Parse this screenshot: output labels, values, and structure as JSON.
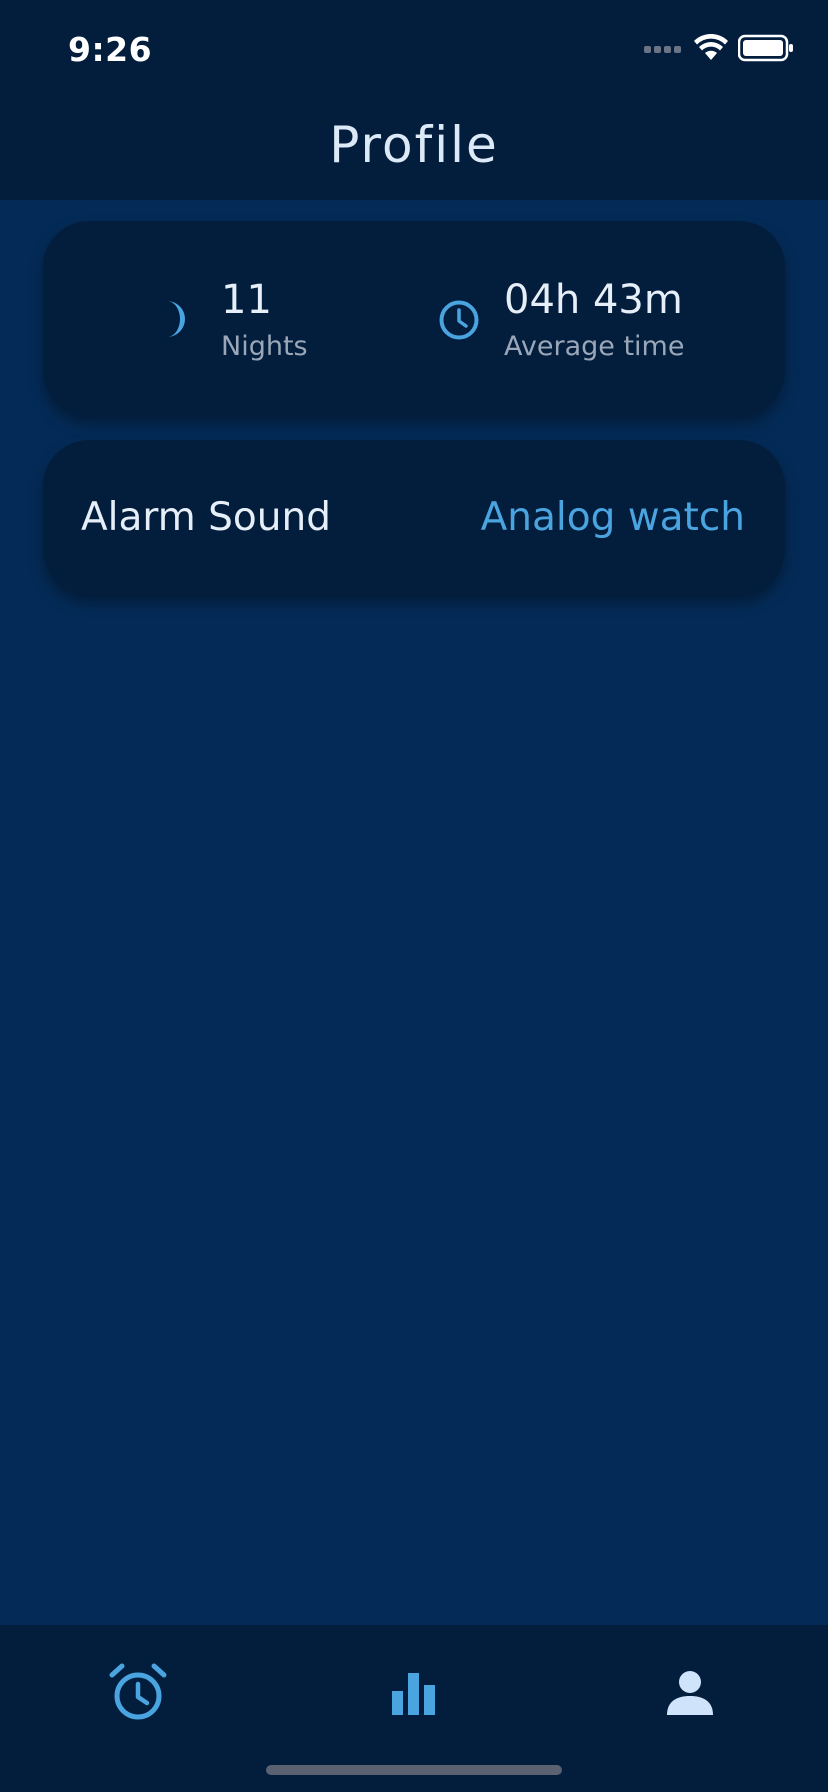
{
  "status_bar": {
    "time": "9:26"
  },
  "header": {
    "title": "Profile"
  },
  "stats": {
    "nights": {
      "value": "11",
      "label": "Nights",
      "icon": "moon-icon"
    },
    "average_time": {
      "value": "04h 43m",
      "label": "Average time",
      "icon": "clock-icon"
    }
  },
  "settings": {
    "alarm_sound": {
      "label": "Alarm Sound",
      "value": "Analog watch"
    }
  },
  "tab_bar": {
    "tabs": [
      {
        "icon": "alarm-clock-icon",
        "active": false
      },
      {
        "icon": "bar-chart-icon",
        "active": false
      },
      {
        "icon": "person-icon",
        "active": true
      }
    ]
  },
  "colors": {
    "background": "#042b57",
    "card": "#031d3d",
    "accent": "#4aa4e0",
    "active_tab": "#cfe4fb",
    "text_primary": "#e6eef8",
    "text_secondary": "#9aa7b8"
  }
}
